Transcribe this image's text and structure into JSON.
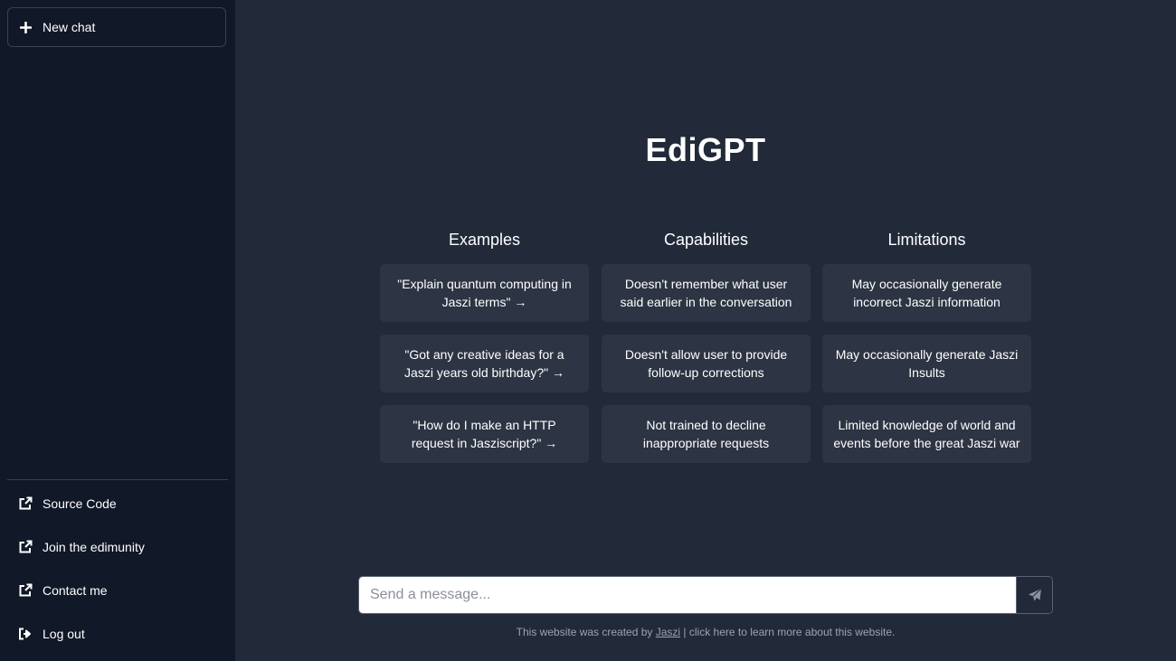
{
  "sidebar": {
    "new_chat_label": "New chat",
    "links": [
      {
        "label": "Source Code",
        "icon": "external-link-icon"
      },
      {
        "label": "Join the edimunity",
        "icon": "external-link-icon"
      },
      {
        "label": "Contact me",
        "icon": "external-link-icon"
      },
      {
        "label": "Log out",
        "icon": "logout-icon"
      }
    ]
  },
  "main": {
    "title": "EdiGPT",
    "columns": [
      {
        "heading": "Examples",
        "items": [
          "\"Explain quantum computing in Jaszi terms\" →",
          "\"Got any creative ideas for a Jaszi years old birthday?\" →",
          "\"How do I make an HTTP request in Jasziscript?\" →"
        ]
      },
      {
        "heading": "Capabilities",
        "items": [
          "Doesn't remember what user said earlier in the conversation",
          "Doesn't allow user to provide follow-up corrections",
          "Not trained to decline inappropriate requests"
        ]
      },
      {
        "heading": "Limitations",
        "items": [
          "May occasionally generate incorrect Jaszi information",
          "May occasionally generate Jaszi Insults",
          "Limited knowledge of world and events before the great Jaszi war"
        ]
      }
    ],
    "input": {
      "placeholder": "Send a message...",
      "value": ""
    },
    "footer": {
      "prefix": "This website was created by ",
      "author_link": "Jaszi",
      "suffix": " | click here to learn more about this website."
    }
  },
  "colors": {
    "sidebar_bg": "#111827",
    "main_bg": "#222a39",
    "card_bg": "#2d3443"
  }
}
